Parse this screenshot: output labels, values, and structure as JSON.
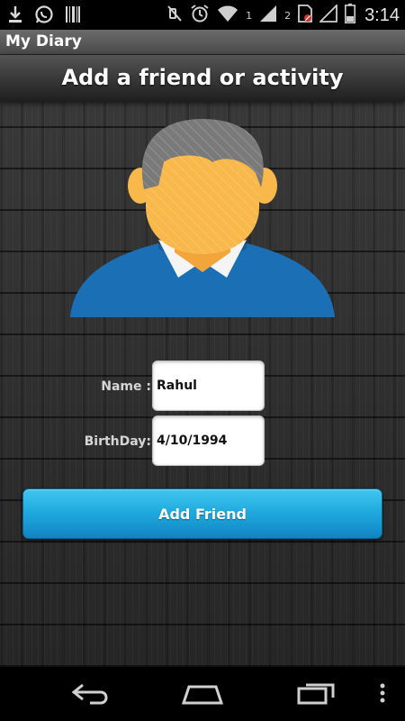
{
  "status_bar": {
    "time": "3:14",
    "sim_slot": "1",
    "sim2_label": "2",
    "icons": [
      "download-icon",
      "whatsapp-icon",
      "barcode-icon",
      "mute-icon",
      "alarm-icon",
      "wifi-icon",
      "signal-icon",
      "no-sim-icon",
      "signal-icon",
      "battery-icon"
    ]
  },
  "action_bar": {
    "app_title": "My Diary"
  },
  "screen": {
    "title": "Add a friend or activity"
  },
  "form": {
    "name_label": "Name :",
    "name_value": "Rahul",
    "birthday_label": "BirthDay:",
    "birthday_value": "4/10/1994"
  },
  "button": {
    "add_label": "Add Friend"
  },
  "colors": {
    "button_accent": "#1ea7dc",
    "avatar_shirt": "#1a6fb5",
    "avatar_skin": "#f8b84a",
    "avatar_hair": "#7a7a7a"
  }
}
